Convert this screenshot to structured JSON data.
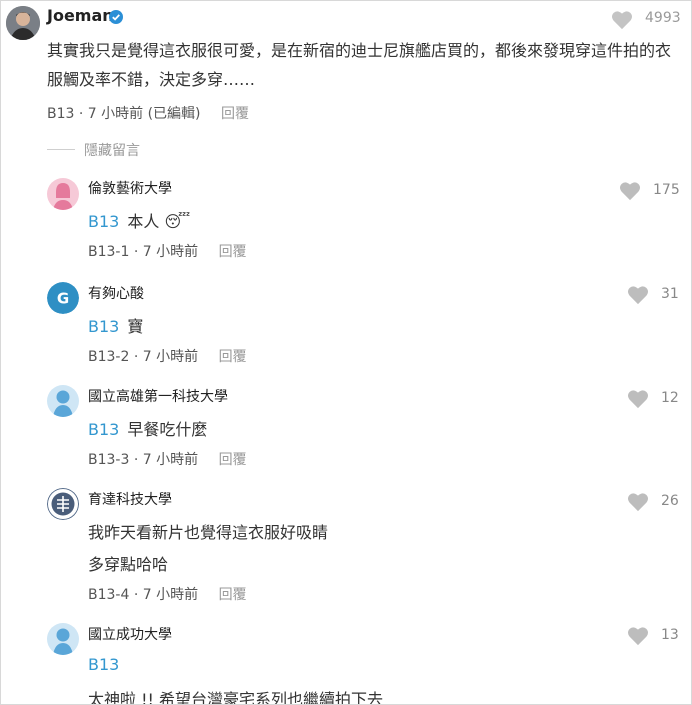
{
  "post": {
    "author": "Joeman",
    "likes": "4993",
    "body": "其實我只是覺得這衣服很可愛，是在新宿的迪士尼旗艦店買的，都後來發現穿這件拍的衣服觸及率不錯，決定多穿……",
    "floor": "B13",
    "time": "7 小時前",
    "edited": "(已編輯)",
    "reply": "回覆"
  },
  "hidden_label": "隱藏留言",
  "comments": [
    {
      "name": "倫敦藝術大學",
      "likes": "175",
      "ref": "B13",
      "text": "本人",
      "emoji": "😴",
      "floor": "B13-1",
      "time": "7 小時前",
      "reply": "回覆"
    },
    {
      "name": "有夠心酸",
      "avatar_letter": "G",
      "likes": "31",
      "ref": "B13",
      "text": "寶",
      "floor": "B13-2",
      "time": "7 小時前",
      "reply": "回覆"
    },
    {
      "name": "國立高雄第一科技大學",
      "likes": "12",
      "ref": "B13",
      "text": "早餐吃什麼",
      "floor": "B13-3",
      "time": "7 小時前",
      "reply": "回覆"
    },
    {
      "name": "育達科技大學",
      "likes": "26",
      "text_line1": "我昨天看新片也覺得這衣服好吸睛",
      "text_line2": "多穿點哈哈",
      "floor": "B13-4",
      "time": "7 小時前",
      "reply": "回覆"
    },
    {
      "name": "國立成功大學",
      "likes": "13",
      "ref": "B13",
      "text": "太神啦 !! 希望台灣豪宅系列也繼續拍下去"
    }
  ],
  "colors": {
    "ref_blue": "#3397cf",
    "heart_gray": "#bdbdbd",
    "avatar_blue": "#5aa6d8",
    "avatar_pink": "#e88aa8",
    "avatar_teal": "#2e8fc4"
  }
}
